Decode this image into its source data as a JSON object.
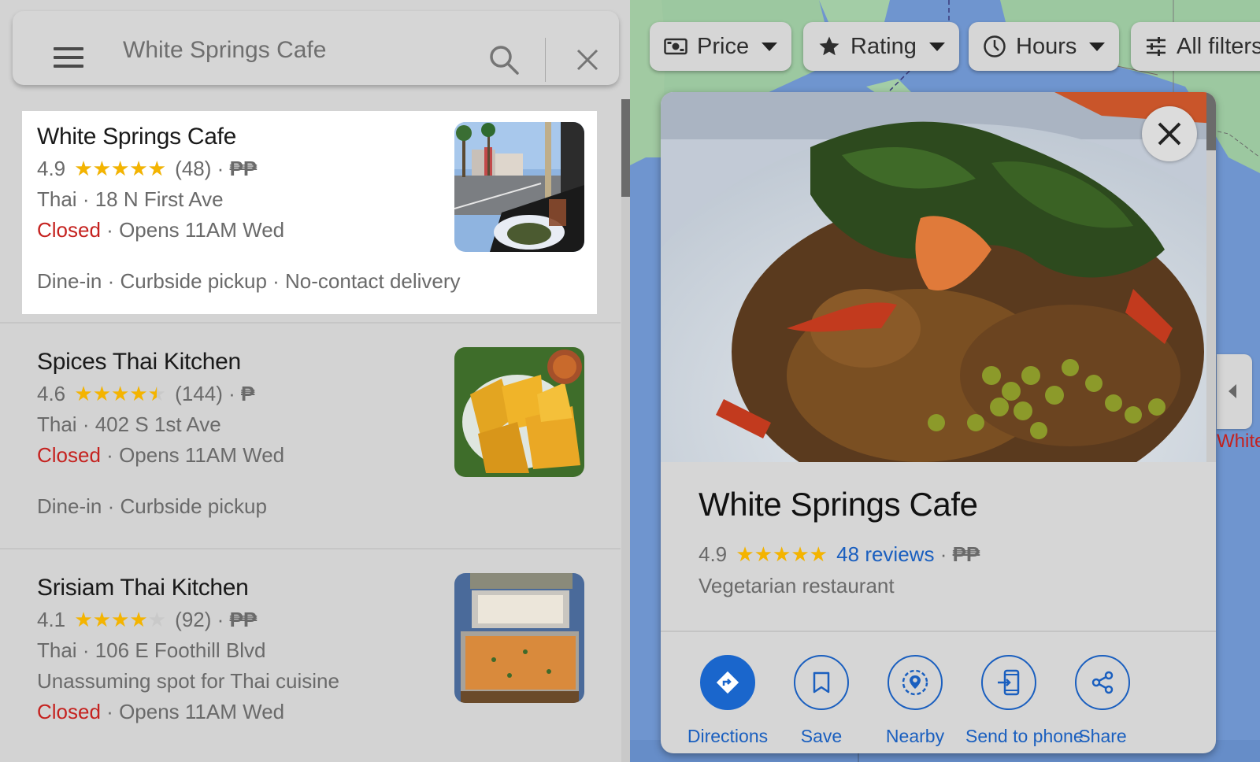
{
  "search": {
    "value": "White Springs Cafe",
    "menu_icon": "hamburger-menu-icon",
    "search_icon": "search-icon",
    "clear_icon": "close-icon"
  },
  "results": [
    {
      "name": "White Springs Cafe",
      "rating": "4.9",
      "rating_value": 4.9,
      "review_count": "(48)",
      "price": "₱₱",
      "category": "Thai",
      "address": "18 N First Ave",
      "status": "Closed",
      "hours": "Opens 11AM Wed",
      "description": "",
      "services": "Dine-in · Curbside pickup · No-contact delivery",
      "selected": true,
      "photo": "street-cafe-photo"
    },
    {
      "name": "Spices Thai Kitchen",
      "rating": "4.6",
      "rating_value": 4.6,
      "review_count": "(144)",
      "price": "₱",
      "category": "Thai",
      "address": "402 S 1st Ave",
      "status": "Closed",
      "hours": "Opens 11AM Wed",
      "description": "",
      "services": "Dine-in · Curbside pickup",
      "selected": false,
      "photo": "crab-rangoon-photo"
    },
    {
      "name": "Srisiam Thai Kitchen",
      "rating": "4.1",
      "rating_value": 4.1,
      "review_count": "(92)",
      "price": "₱₱",
      "category": "Thai",
      "address": "106 E Foothill Blvd",
      "status": "Closed",
      "hours": "Opens 11AM Wed",
      "description": "Unassuming spot for Thai cuisine",
      "services": "",
      "selected": false,
      "photo": "curry-tray-photo"
    }
  ],
  "separator": "·",
  "filters": [
    {
      "label": "Price",
      "icon": "price-icon",
      "has_dropdown": true
    },
    {
      "label": "Rating",
      "icon": "star-icon",
      "has_dropdown": true
    },
    {
      "label": "Hours",
      "icon": "clock-icon",
      "has_dropdown": true
    },
    {
      "label": "All filters",
      "icon": "tune-icon",
      "has_dropdown": false
    }
  ],
  "map": {
    "pin_label": "White",
    "collapse_icon": "chevron-left-icon"
  },
  "place_card": {
    "name": "White Springs Cafe",
    "rating": "4.9",
    "rating_value": 4.9,
    "reviews_link": "48 reviews",
    "price": "₱₱",
    "category": "Vegetarian restaurant",
    "photo": "thai-basil-dish-photo",
    "actions": [
      {
        "label": "Directions",
        "icon": "directions-icon",
        "primary": true
      },
      {
        "label": "Save",
        "icon": "bookmark-icon",
        "primary": false
      },
      {
        "label": "Nearby",
        "icon": "nearby-icon",
        "primary": false
      },
      {
        "label": "Send to phone",
        "icon": "send-to-phone-icon",
        "primary": false
      },
      {
        "label": "Share",
        "icon": "share-icon",
        "primary": false
      }
    ]
  },
  "colors": {
    "accent_blue": "#1a66cc",
    "link_blue": "#1a5fbf",
    "star": "#f4b400",
    "closed_red": "#c5221f"
  }
}
